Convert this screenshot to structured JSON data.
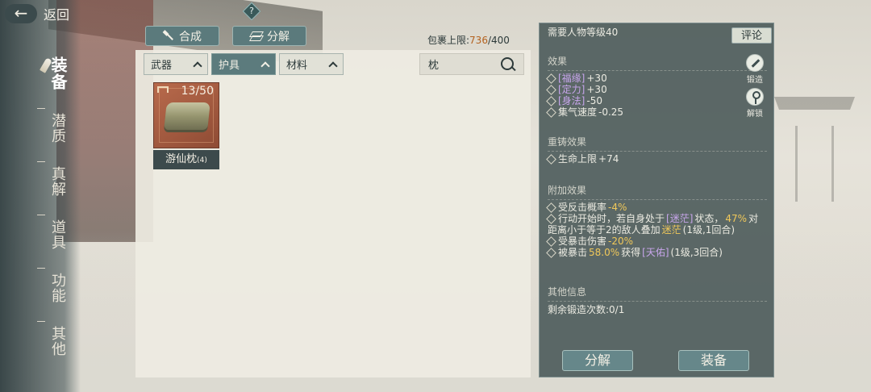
{
  "header": {
    "back_label": "返回",
    "help_glyph": "?"
  },
  "sidebar": {
    "items": [
      {
        "label": "装备",
        "active": true
      },
      {
        "label": "潜质",
        "active": false
      },
      {
        "label": "真解",
        "active": false
      },
      {
        "label": "道具",
        "active": false
      },
      {
        "label": "功能",
        "active": false
      },
      {
        "label": "其他",
        "active": false
      }
    ]
  },
  "toolbar": {
    "craft_label": "合成",
    "craft_icon": "hammer-icon",
    "dismantle_label": "分解",
    "dismantle_icon": "layers-icon",
    "capacity_prefix": "包裹上限:",
    "capacity_used": "736",
    "capacity_max": "/400"
  },
  "filters": {
    "tabs": [
      {
        "label": "武器",
        "active": false
      },
      {
        "label": "护具",
        "active": true
      },
      {
        "label": "材料",
        "active": false
      }
    ],
    "search_value": "枕"
  },
  "inventory": {
    "items": [
      {
        "name": "游仙枕",
        "level": "(4)",
        "count": "13/50",
        "icon": "pillow-icon"
      }
    ]
  },
  "detail": {
    "required_level": "需要人物等级40",
    "comment_label": "评论",
    "tools": [
      {
        "label": "锻造",
        "icon": "forge-icon"
      },
      {
        "label": "解锁",
        "icon": "key-icon"
      }
    ],
    "effects_title": "效果",
    "effects": [
      {
        "tag": "[福缘]",
        "value": "+30"
      },
      {
        "tag": "[定力]",
        "value": "+30"
      },
      {
        "tag": "[身法]",
        "value": "-50"
      },
      {
        "tag": "",
        "text": "集气速度",
        "value": "-0.25"
      }
    ],
    "reforge_title": "重铸效果",
    "reforge": [
      {
        "text": "生命上限",
        "value": "+74"
      }
    ],
    "extra_title": "附加效果",
    "extra": {
      "line1_text": "受反击概率",
      "line1_value": "-4%",
      "line2_a": "行动开始时，若自身处于",
      "line2_tag": "[迷茫]",
      "line2_b": "状态，",
      "line2_pct": "47%",
      "line2_c": "对",
      "line3_a": "距离小于等于2的敌人叠加",
      "line3_tag": "迷茫",
      "line3_b": "(1级,1回合)",
      "line4_text": "受暴击伤害",
      "line4_value": "-20%",
      "line5_a": "被暴击",
      "line5_pct": "58.0%",
      "line5_b": "获得",
      "line5_tag": "[天佑]",
      "line5_c": "(1级,3回合)"
    },
    "other_title": "其他信息",
    "other_text": "剩余锻造次数:0/1",
    "dismantle_label": "分解",
    "equip_label": "装备"
  },
  "colors": {
    "accent_teal": "#5c7b7d",
    "item_frame": "#a0583e",
    "tag_purple": "#c8a6ec",
    "highlight_gold": "#f0c85a",
    "capacity_orange": "#b3611f"
  }
}
